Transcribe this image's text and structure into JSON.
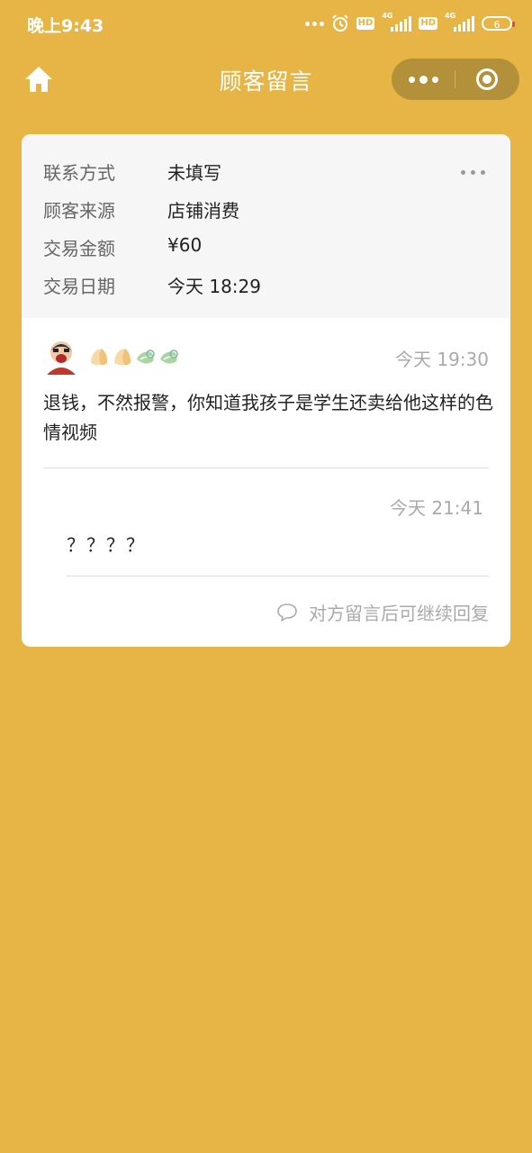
{
  "status_bar": {
    "time": "晚上9:43",
    "hd_label": "HD",
    "network": "4G",
    "battery": "6",
    "icons": [
      "more-dots-icon",
      "alarm-icon",
      "hd-icon",
      "signal-icon",
      "hd-icon",
      "signal-icon",
      "battery-icon"
    ],
    "battery_low_color": "#e04a3a"
  },
  "navbar": {
    "title": "顾客留言",
    "icons": [
      "home-icon",
      "more-icon",
      "close-target-icon"
    ]
  },
  "info": {
    "rows": [
      {
        "label": "联系方式",
        "value": "未填写"
      },
      {
        "label": "顾客来源",
        "value": "店铺消费"
      },
      {
        "label": "交易金额",
        "value": "¥60"
      },
      {
        "label": "交易日期",
        "value": "今天 18:29"
      }
    ]
  },
  "message": {
    "time": "今天 19:30",
    "text": "退钱，不然报警，你知道我孩子是学生还卖给他这样的色情视频",
    "name_icons": [
      "dumpling-icon",
      "dumpling-icon",
      "leaf-icon",
      "leaf-icon"
    ]
  },
  "reply": {
    "time": "今天 21:41",
    "text": "？？？？"
  },
  "footer": {
    "tip": "对方留言后可继续回复",
    "icon": "comment-icon"
  },
  "colors": {
    "background": "#E6B546",
    "capsule": "#B3903A",
    "card": "#FFFFFF",
    "info_background": "#F6F6F6"
  }
}
